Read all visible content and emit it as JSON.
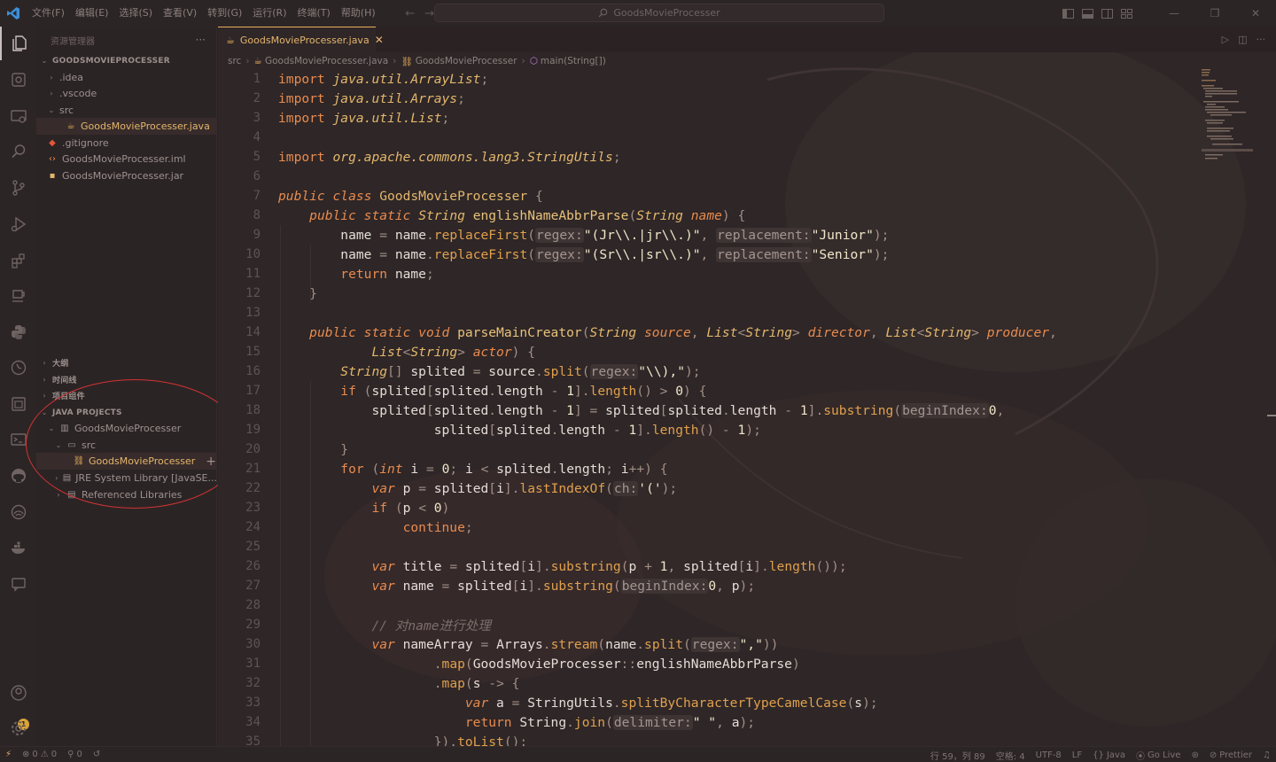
{
  "menu": [
    "文件(F)",
    "编辑(E)",
    "选择(S)",
    "查看(V)",
    "转到(G)",
    "运行(R)",
    "终端(T)",
    "帮助(H)"
  ],
  "search": {
    "text": "GoodsMovieProcesser"
  },
  "explorer": {
    "title": "资源管理器",
    "more": "···",
    "project_title": "GOODSMOVIEPROCESSER",
    "files": [
      ".idea",
      ".vscode",
      "src",
      "GoodsMovieProcesser.java",
      ".gitignore",
      "GoodsMovieProcesser.iml",
      "GoodsMovieProcesser.jar"
    ],
    "sections": [
      "大纲",
      "时间线",
      "项目组件"
    ],
    "java_projects": {
      "title": "JAVA PROJECTS",
      "items": [
        "GoodsMovieProcesser",
        "src",
        "GoodsMovieProcesser",
        "JRE System Library [JavaSE...",
        "Referenced Libraries"
      ]
    }
  },
  "tab": {
    "label": "GoodsMovieProcesser.java",
    "close": "✕"
  },
  "breadcrumb": [
    "src",
    "GoodsMovieProcesser.java",
    "GoodsMovieProcesser",
    "main(String[])"
  ],
  "line_numbers": [
    "1",
    "2",
    "3",
    "4",
    "5",
    "6",
    "7",
    "8",
    "9",
    "10",
    "11",
    "12",
    "13",
    "14",
    "15",
    "16",
    "17",
    "18",
    "19",
    "20",
    "21",
    "22",
    "23",
    "24",
    "25",
    "26",
    "27",
    "28",
    "29",
    "30",
    "31",
    "32",
    "33",
    "34",
    "35"
  ],
  "status": {
    "errors": "0",
    "warnings": "0",
    "ports": "0",
    "cursor": "行 59，列 89",
    "spaces": "空格: 4",
    "encoding": "UTF-8",
    "eol": "LF",
    "language": "Java",
    "golive": "Go Live",
    "prettier": "Prettier"
  },
  "account_badge": "1",
  "colors": {
    "accent": "#e8ad5a",
    "keyword": "#e88b4e",
    "annotation_circle": "#d23333"
  }
}
